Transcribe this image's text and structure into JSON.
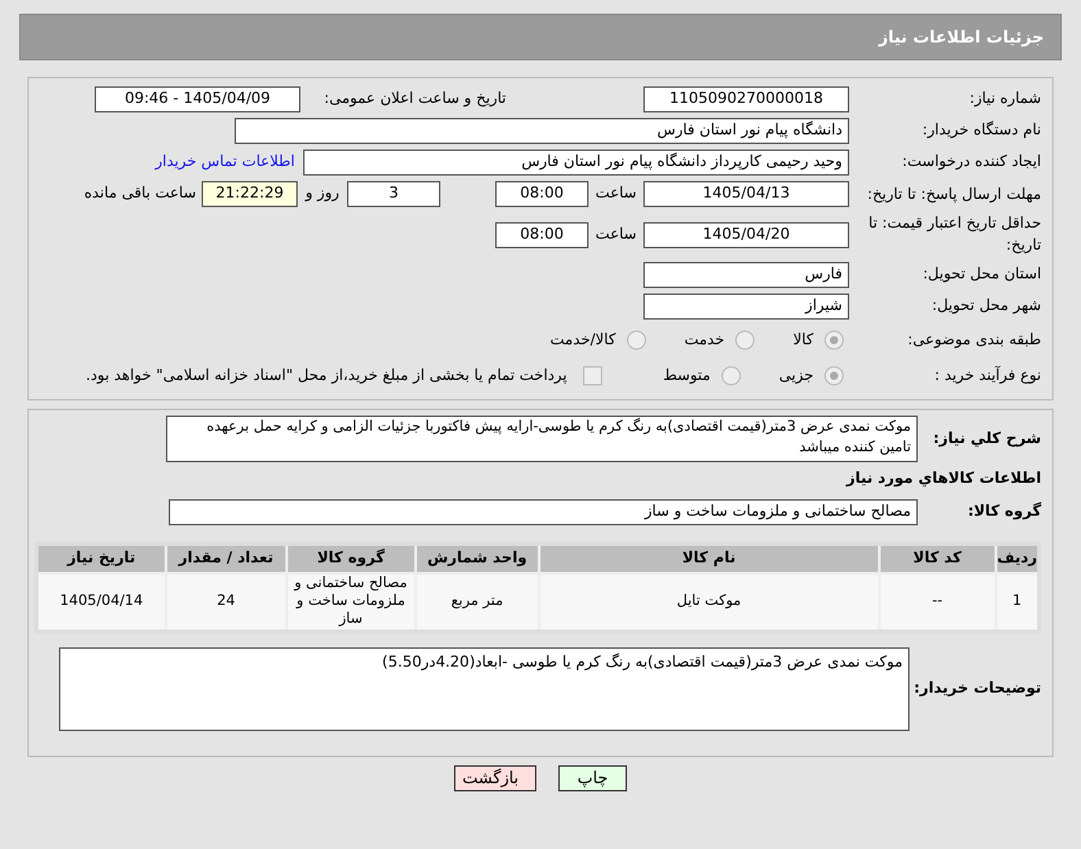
{
  "header": {
    "title": "جزئیات اطلاعات نیاز"
  },
  "need_number": {
    "label": "شماره نیاز:",
    "value": "1105090270000018"
  },
  "announce": {
    "label": "تاریخ و ساعت اعلان عمومی:",
    "value": "1405/04/09 - 09:46"
  },
  "buyer_org": {
    "label": "نام دستگاه خریدار:",
    "value": "دانشگاه پیام نور استان فارس"
  },
  "requester": {
    "label": "ایجاد کننده درخواست:",
    "value": "وحید رحیمی کارپرداز دانشگاه پیام نور استان فارس",
    "link": "اطلاعات تماس خریدار"
  },
  "deadline": {
    "label": "مهلت ارسال پاسخ: تا تاریخ:",
    "date": "1405/04/13",
    "time_label": "ساعت",
    "time": "08:00",
    "days": "3",
    "days_label": "روز و",
    "remaining": "21:22:29",
    "remaining_label": "ساعت باقی مانده"
  },
  "validity": {
    "label": "حداقل تاریخ اعتبار قیمت: تا تاریخ:",
    "date": "1405/04/20",
    "time_label": "ساعت",
    "time": "08:00"
  },
  "province": {
    "label": "استان محل تحویل:",
    "value": "فارس"
  },
  "city": {
    "label": "شهر محل تحویل:",
    "value": "شیراز"
  },
  "category": {
    "label": "طبقه بندی موضوعی:",
    "options": [
      {
        "label": "کالا",
        "selected": true
      },
      {
        "label": "خدمت",
        "selected": false
      },
      {
        "label": "کالا/خدمت",
        "selected": false
      }
    ]
  },
  "process": {
    "label": "نوع فرآیند خرید :",
    "options": [
      {
        "label": "جزیی",
        "selected": true
      },
      {
        "label": "متوسط",
        "selected": false
      }
    ],
    "payment": {
      "label": "پرداخت تمام یا بخشی از مبلغ خرید،از محل \"اسناد خزانه اسلامی\" خواهد بود.",
      "checked": false
    }
  },
  "description": {
    "label": "شرح کلي نياز:",
    "value": "موکت نمدی عرض 3متر(قیمت اقتصادی)به رنگ کرم یا طوسی-ارایه پیش فاکتوربا جزئیات الزامی و کرایه حمل برعهده تامین کننده میباشد"
  },
  "goods_title": "اطلاعات کالاهاي مورد نياز",
  "goods_group": {
    "label": "گروه کالا:",
    "value": "مصالح ساختمانی و ملزومات ساخت و ساز"
  },
  "table": {
    "columns": [
      "ردیف",
      "کد کالا",
      "نام کالا",
      "واحد شمارش",
      "گروه کالا",
      "تعداد / مقدار",
      "تاریخ نیاز"
    ],
    "rows": [
      [
        "1",
        "--",
        "موکت تایل",
        "متر مربع",
        "مصالح ساختمانی و ملزومات ساخت و ساز",
        "24",
        "1405/04/14"
      ]
    ]
  },
  "buyer_notes": {
    "label": "توضیحات خریدار:",
    "value": "موکت نمدی عرض 3متر(قیمت اقتصادی)به رنگ کرم یا طوسی -ابعاد(4.20در5.50)"
  },
  "buttons": [
    {
      "label": "چاپ",
      "kind": "print"
    },
    {
      "label": "بازگشت",
      "kind": "back"
    }
  ]
}
